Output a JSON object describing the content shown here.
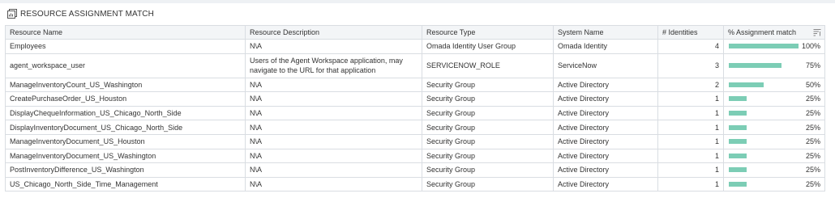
{
  "panel": {
    "title": "RESOURCE ASSIGNMENT MATCH",
    "title_icon": "report-icon"
  },
  "columns": {
    "resource_name": "Resource Name",
    "resource_description": "Resource Description",
    "resource_type": "Resource Type",
    "system_name": "System Name",
    "identities": "# Identities",
    "assignment_match": "% Assignment match",
    "sort_icon": "sort-descending-icon"
  },
  "accent_color": "#7ccdb5",
  "rows": [
    {
      "name": "Employees",
      "description": "N\\A",
      "type": "Omada Identity User Group",
      "system": "Omada Identity",
      "identities": "4",
      "match": 100,
      "match_label": "100%"
    },
    {
      "name": "agent_workspace_user",
      "description": "Users of the Agent Workspace application, may navigate to the URL for that application",
      "type": "SERVICENOW_ROLE",
      "system": "ServiceNow",
      "identities": "3",
      "match": 75,
      "match_label": "75%"
    },
    {
      "name": "ManageInventoryCount_US_Washington",
      "description": "N\\A",
      "type": "Security Group",
      "system": "Active Directory",
      "identities": "2",
      "match": 50,
      "match_label": "50%"
    },
    {
      "name": "CreatePurchaseOrder_US_Houston",
      "description": "N\\A",
      "type": "Security Group",
      "system": "Active Directory",
      "identities": "1",
      "match": 25,
      "match_label": "25%"
    },
    {
      "name": "DisplayChequeInformation_US_Chicago_North_Side",
      "description": "N\\A",
      "type": "Security Group",
      "system": "Active Directory",
      "identities": "1",
      "match": 25,
      "match_label": "25%"
    },
    {
      "name": "DisplayInventoryDocument_US_Chicago_North_Side",
      "description": "N\\A",
      "type": "Security Group",
      "system": "Active Directory",
      "identities": "1",
      "match": 25,
      "match_label": "25%"
    },
    {
      "name": "ManageInventoryDocument_US_Houston",
      "description": "N\\A",
      "type": "Security Group",
      "system": "Active Directory",
      "identities": "1",
      "match": 25,
      "match_label": "25%"
    },
    {
      "name": "ManageInventoryDocument_US_Washington",
      "description": "N\\A",
      "type": "Security Group",
      "system": "Active Directory",
      "identities": "1",
      "match": 25,
      "match_label": "25%"
    },
    {
      "name": "PostInventoryDifference_US_Washington",
      "description": "N\\A",
      "type": "Security Group",
      "system": "Active Directory",
      "identities": "1",
      "match": 25,
      "match_label": "25%"
    },
    {
      "name": "US_Chicago_North_Side_Time_Management",
      "description": "N\\A",
      "type": "Security Group",
      "system": "Active Directory",
      "identities": "1",
      "match": 25,
      "match_label": "25%"
    }
  ]
}
